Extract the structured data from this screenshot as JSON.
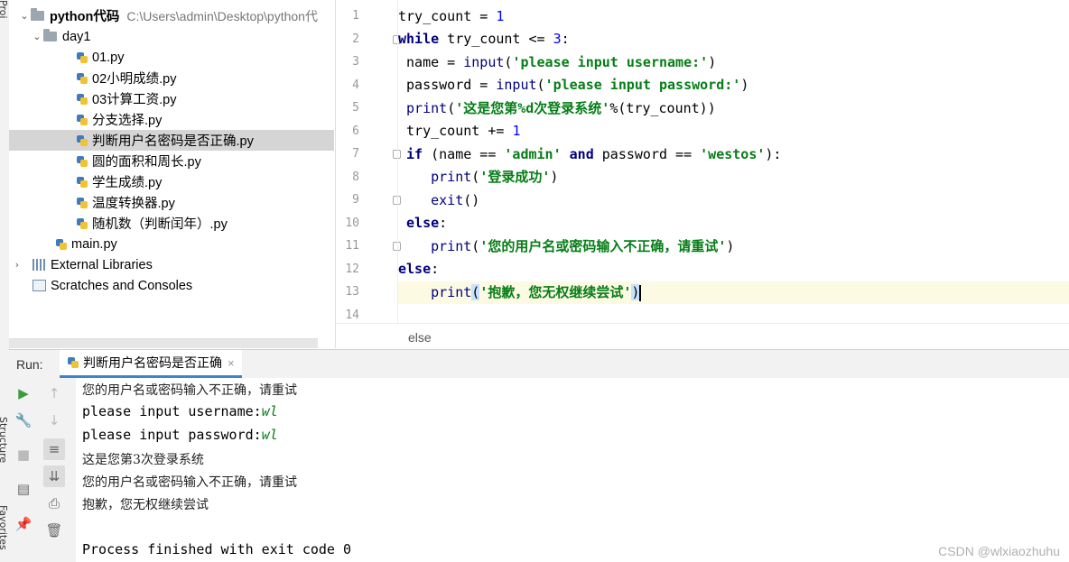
{
  "left_strip": {
    "top_label": "Proj",
    "mid_label": "Structure",
    "bottom_label": "Favorites"
  },
  "project": {
    "root": {
      "name": "python代码",
      "path": "C:\\Users\\admin\\Desktop\\python代"
    },
    "folder": "day1",
    "files": [
      "01.py",
      "02小明成绩.py",
      "03计算工资.py",
      "分支选择.py",
      "判断用户名密码是否正确.py",
      "圆的面积和周长.py",
      "学生成绩.py",
      "温度转换器.py",
      "随机数（判断闰年）.py"
    ],
    "selected_index": 4,
    "main_file": "main.py",
    "external_libraries": "External Libraries",
    "scratches": "Scratches and Consoles"
  },
  "editor": {
    "line_numbers": [
      "1",
      "2",
      "3",
      "4",
      "5",
      "6",
      "7",
      "8",
      "9",
      "10",
      "11",
      "12",
      "13",
      "14"
    ],
    "current_line": 13,
    "breadcrumb": "else"
  },
  "run": {
    "label": "Run:",
    "tab_title": "判断用户名密码是否正确",
    "output": {
      "line1": "您的用户名或密码输入不正确，请重试",
      "prompt_user": "please input username:",
      "user_value": "wl",
      "prompt_pass": "please input password:",
      "pass_value": "wl",
      "line4": "这是您第3次登录系统",
      "line5": "您的用户名或密码输入不正确，请重试",
      "line6": "抱歉，您无权继续尝试",
      "finished": "Process finished with exit code 0"
    }
  },
  "watermark": "CSDN @wlxiaozhuhu",
  "colors": {
    "keyword": "#000080",
    "string": "#067d17",
    "number": "#0000ff",
    "accent": "#4083c9"
  }
}
